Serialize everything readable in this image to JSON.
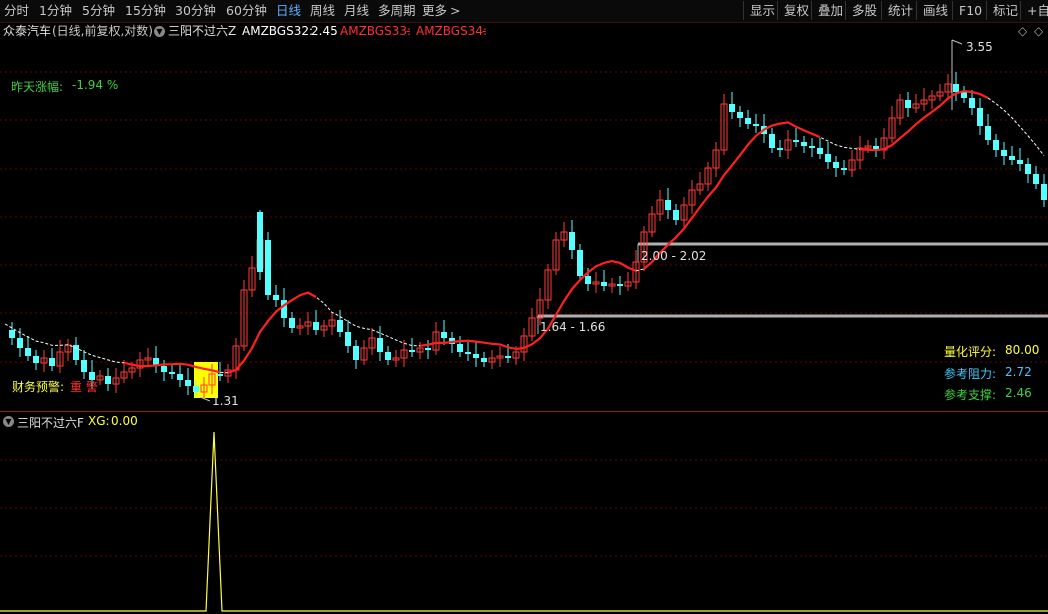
{
  "toolbar": {
    "timeframes": [
      "分时",
      "1分钟",
      "5分钟",
      "15分钟",
      "30分钟",
      "60分钟",
      "日线",
      "周线",
      "月线",
      "多周期",
      "更多"
    ],
    "active_timeframe": "日线",
    "more_arrow": ">",
    "right_buttons": [
      "显示",
      "复权",
      "叠加",
      "多股",
      "统计",
      "画线",
      "F10",
      "标记",
      "+自选"
    ]
  },
  "infobar": {
    "stock_name": "众泰汽车",
    "period_mode": "(日线,前复权,对数)",
    "indicator_name": "三阳不过六Z",
    "ind1_label": "AMZBGS32:",
    "ind1_value": "2.45",
    "ind2_label": "AMZBGS33:",
    "ind2_value": "-",
    "ind3_label": "AMZBGS34:",
    "ind3_value": "-",
    "diamond_icon": "◇"
  },
  "main_chart": {
    "yesterday_change_label": "昨天涨幅:",
    "yesterday_change_value": "-1.94 %",
    "high_label": "3.55",
    "low_label": "1.31",
    "zone1_label": "2.00 - 2.02",
    "zone2_label": "1.64 - 1.66",
    "finance_warning": "财务预警:",
    "warning_text": "重 警",
    "score_label": "量化评分:",
    "score_value": "80.00",
    "resistance_label": "参考阻力:",
    "resistance_value": "2.72",
    "support_label": "参考支撑:",
    "support_value": "2.46"
  },
  "sub_chart": {
    "indicator_name": "三阳不过六F",
    "xg_label": "XG:",
    "xg_value": "0.00"
  },
  "colors": {
    "up": "#ff3c3c",
    "down": "#54ffff",
    "grid": "#6e0000",
    "ma": "#ff2020",
    "white_line": "#ffffff",
    "yellow": "#ffff40",
    "green_text": "#40d040",
    "cyan_text": "#40c8ff"
  }
}
